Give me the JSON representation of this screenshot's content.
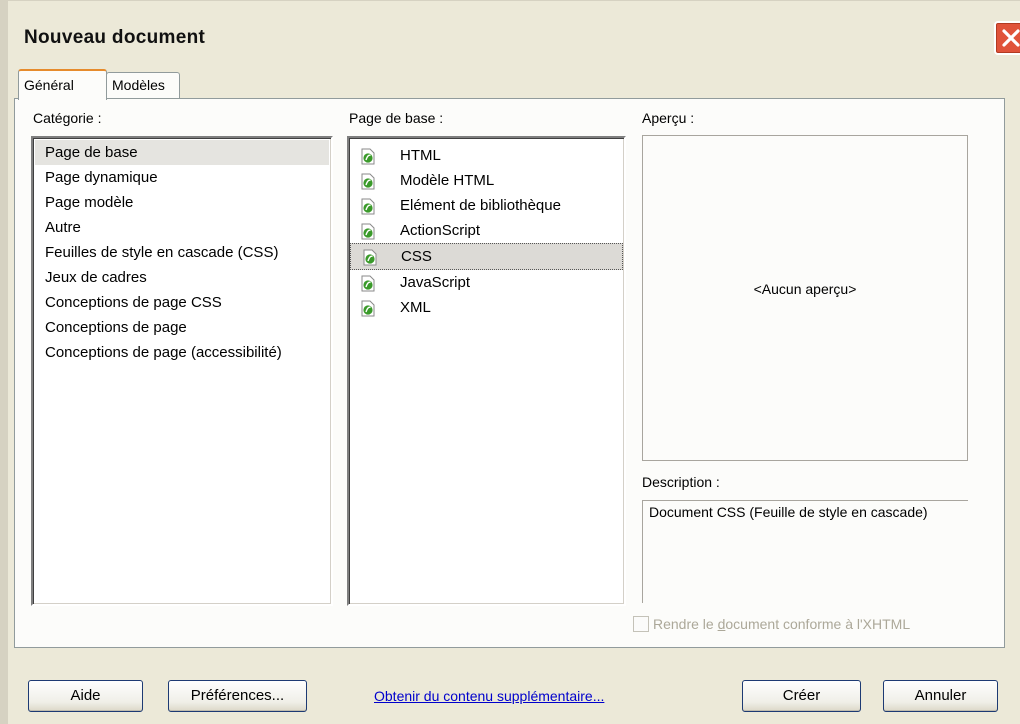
{
  "window": {
    "title": "Nouveau document"
  },
  "tabs": [
    {
      "label": "Général",
      "active": true
    },
    {
      "label": "Modèles",
      "active": false
    }
  ],
  "category": {
    "label": "Catégorie :",
    "items": [
      "Page de base",
      "Page dynamique",
      "Page modèle",
      "Autre",
      "Feuilles de style en cascade (CSS)",
      "Jeux de cadres",
      "Conceptions de page CSS",
      "Conceptions de page",
      "Conceptions de page (accessibilité)"
    ],
    "selected_index": 0
  },
  "page_base": {
    "label": "Page de base :",
    "items": [
      "HTML",
      "Modèle HTML",
      "Elément de bibliothèque",
      "ActionScript",
      "CSS",
      "JavaScript",
      "XML"
    ],
    "selected_index": 4
  },
  "preview": {
    "label": "Aperçu :",
    "text": "<Aucun aperçu>"
  },
  "description": {
    "label": "Description :",
    "text": "Document CSS (Feuille de style en cascade)"
  },
  "xhtml_checkbox": {
    "label_before": "Rendre le ",
    "label_accel": "d",
    "label_after": "ocument conforme à l'XHTML",
    "checked": false,
    "enabled": false
  },
  "buttons": {
    "help": "Aide",
    "preferences": "Préférences...",
    "create": "Créer",
    "cancel": "Annuler"
  },
  "link": {
    "text": "Obtenir du contenu supplémentaire..."
  },
  "colors": {
    "close": "#e0533a",
    "tab_accent": "#e68b2c",
    "link": "#0000cc",
    "file_icon": "#3a9a2a"
  }
}
